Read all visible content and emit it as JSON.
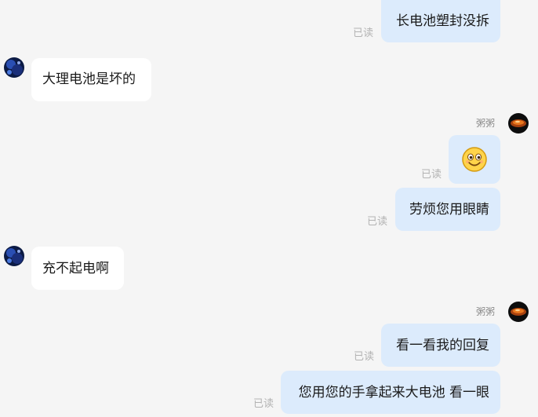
{
  "messages": [
    {
      "direction": "out",
      "text": "长电池塑封没拆",
      "status": "已读"
    },
    {
      "direction": "in",
      "avatar_icon": "contact-avatar-dark-blue",
      "text": "大理电池是坏的"
    },
    {
      "direction": "out",
      "sender": "粥粥",
      "avatar_icon": "self-avatar-orange",
      "emoji": "smiley-face-icon",
      "status": "已读"
    },
    {
      "direction": "out",
      "text": "劳烦您用眼睛",
      "status": "已读"
    },
    {
      "direction": "in",
      "avatar_icon": "contact-avatar-dark-blue",
      "text": "充不起电啊"
    },
    {
      "direction": "out",
      "sender": "粥粥",
      "avatar_icon": "self-avatar-orange",
      "text": "看一看我的回复",
      "status": "已读"
    },
    {
      "direction": "out",
      "text": "您用您的手拿起来大电池 看一眼",
      "status": "已读"
    }
  ],
  "colors": {
    "background": "#f5f5f5",
    "bubble_outgoing": "#dcebfc",
    "bubble_incoming": "#ffffff",
    "read_status": "#b3b3b3",
    "sender_name": "#8c8c8c"
  }
}
